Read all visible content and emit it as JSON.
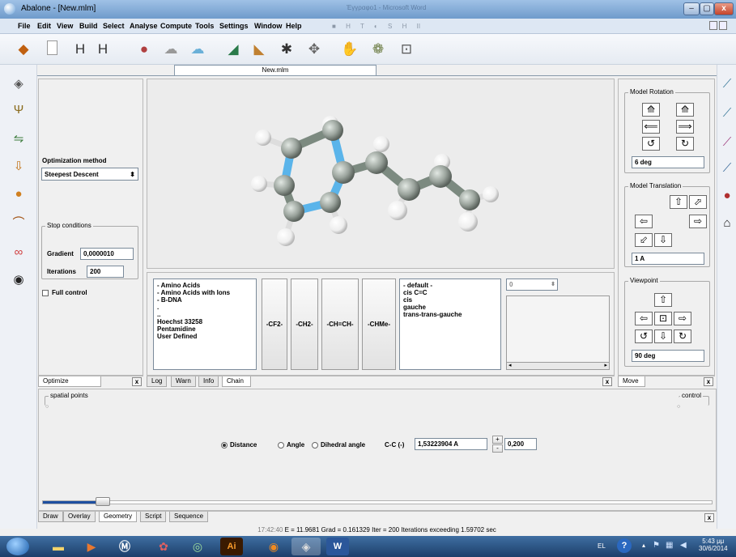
{
  "window": {
    "title": "Abalone - [New.mlm]",
    "bg_title": "Έγγραφο1 - Microsoft Word",
    "minimize": "–",
    "maximize": "▢",
    "close": "x"
  },
  "menu": [
    "File",
    "Edit",
    "View",
    "Build",
    "Select",
    "Analyse",
    "Compute",
    "Tools",
    "Settings",
    "Window",
    "Help"
  ],
  "media_controls": [
    "■",
    "H",
    "T",
    "◐",
    "S",
    "H",
    "II"
  ],
  "toolbar_icons": [
    "book-icon",
    "new-document-icon",
    "save-icon",
    "save-all-icon",
    "protein-icon",
    "cloud-icon",
    "molecule-surface-icon",
    "triangle-icon",
    "angle-icon",
    "star-icon",
    "diamond-icon",
    "hand-icon",
    "network-icon",
    "pin-icon"
  ],
  "document_tab": "New.mlm",
  "optimize": {
    "method_label": "Optimization method",
    "method_value": "Steepest Descent",
    "stop_title": "Stop conditions",
    "gradient_label": "Gradient",
    "gradient_value": "0,0000010",
    "iterations_label": "Iterations",
    "iterations_value": "200",
    "full_control": "Full control",
    "tab": "Optimize",
    "close": "x"
  },
  "chain": {
    "list1": [
      "- Amino Acids",
      "- Amino Acids with Ions",
      "- B-DNA",
      ".",
      "..",
      "Hoechst 33258",
      "Pentamidine",
      "User Defined"
    ],
    "buttons": [
      "-CF2-",
      "-CH2-",
      "-CH=CH-",
      "-CHMe-"
    ],
    "list2": [
      "- default -",
      "cis C=C",
      "cis",
      "gauche",
      "trans-trans-gauche"
    ],
    "spin_value": "0",
    "tabs": [
      "Log",
      "Warn",
      "Info",
      "Chain"
    ],
    "active_tab": "Chain",
    "close": "x"
  },
  "right_panel": {
    "rotation_title": "Model Rotation",
    "rotation_value": "6 deg",
    "translation_title": "Model Translation",
    "translation_value": "1 A",
    "viewpoint_title": "Viewpoint",
    "viewpoint_value": "90 deg",
    "tab": "Move",
    "close": "x"
  },
  "geometry": {
    "spatial_points": "spatial points",
    "control": "control",
    "options": [
      "Distance",
      "Angle",
      "Dihedral angle"
    ],
    "selected": "Distance",
    "bond_label": "C-C  (-)",
    "bond_value": "1,53223904 A",
    "step_value": "0,200",
    "plus": "+",
    "minus": "-",
    "tabs": [
      "Draw",
      "Overlay",
      "Geometry",
      "Script",
      "Sequence"
    ],
    "active_tab": "Geometry",
    "close": "x",
    "slider_value": 0.08
  },
  "status": {
    "time": "17:42:40",
    "text": "E = 11.9681 Grad = 0.161329 Iter = 200 Iterations exceeding 1.59702 sec"
  },
  "taskbar": {
    "items": [
      "start-orb-icon",
      "explorer-icon",
      "media-player-icon",
      "m-icon",
      "paint-icon",
      "cd-icon",
      "illustrator-icon",
      "firefox-icon",
      "abalone-icon",
      "word-icon"
    ],
    "illustrator_label": "Ai",
    "word_label": "W",
    "lang": "EL",
    "time": "5:43 μμ",
    "date": "30/6/2014"
  },
  "colors": {
    "carbon": "#9aa39c",
    "nitrogen": "#5ab4ea",
    "hydrogen": "#f4f4f4",
    "bond": "#8f9788"
  }
}
